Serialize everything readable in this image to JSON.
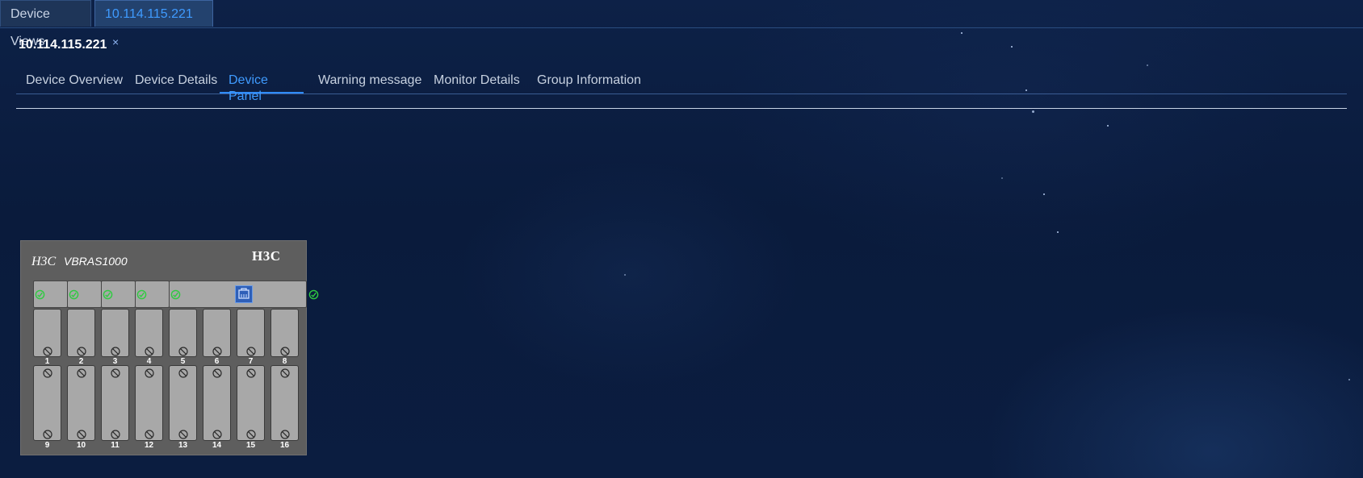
{
  "window_tabs": [
    {
      "label": "Device Views"
    },
    {
      "label": "10.114.115.221",
      "close": "×"
    }
  ],
  "page_title": "10.114.115.221",
  "sub_tabs": [
    {
      "label": "Device Overview"
    },
    {
      "label": "Device Details"
    },
    {
      "label": "Device Panel",
      "active": true
    },
    {
      "label": "Warning message"
    },
    {
      "label": "Monitor Details"
    },
    {
      "label": "Group Information"
    }
  ],
  "device": {
    "brand": "H3C",
    "model": "VBRAS1000",
    "logo": "H3C",
    "top_slots": [
      {
        "status": "ok",
        "status_icon": "check-circle-icon"
      },
      {
        "status": "ok",
        "status_icon": "check-circle-icon"
      },
      {
        "status": "ok",
        "status_icon": "check-circle-icon"
      },
      {
        "status": "ok",
        "status_icon": "check-circle-icon"
      },
      {
        "status": "ok",
        "status_icon": "check-circle-icon",
        "port_icon": "ethernet-port-icon"
      }
    ],
    "upper_slots": [
      "1",
      "2",
      "3",
      "4",
      "5",
      "6",
      "7",
      "8"
    ],
    "lower_slots": [
      "9",
      "10",
      "11",
      "12",
      "13",
      "14",
      "15",
      "16"
    ]
  },
  "colors": {
    "accent": "#3f9bff",
    "background": "#0b1d40",
    "panel": "#5e5e5e",
    "slot": "#a8a8a8",
    "ok_led": "#2ecc40"
  }
}
